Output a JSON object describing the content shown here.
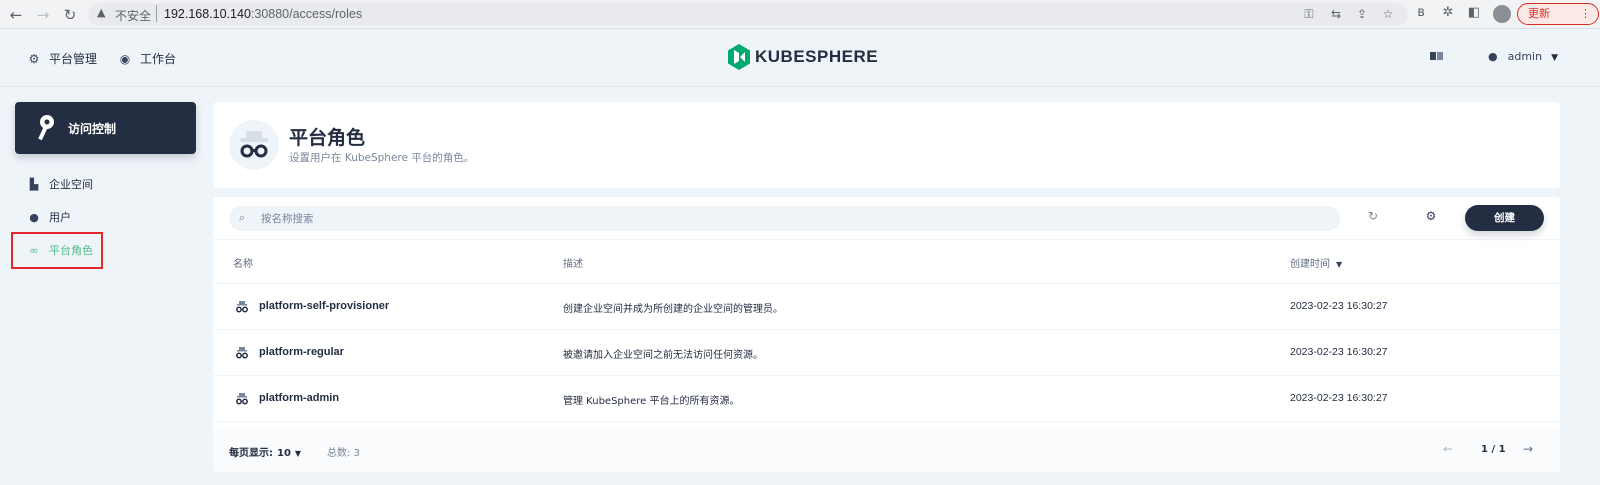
{
  "browser": {
    "insecure_label": "不安全",
    "url_host": "192.168.10.140",
    "url_rest": ":30880/access/roles",
    "update_label": "更新"
  },
  "header": {
    "nav": [
      {
        "label": "平台管理",
        "icon": "gear-icon"
      },
      {
        "label": "工作台",
        "icon": "dashboard-icon"
      }
    ],
    "brand": "KUBESPHERE",
    "user": "admin"
  },
  "sidebar": {
    "title": "访问控制",
    "items": [
      {
        "label": "企业空间",
        "icon": "enterprise-icon"
      },
      {
        "label": "用户",
        "icon": "user-icon"
      },
      {
        "label": "平台角色",
        "icon": "role-icon",
        "active": true
      }
    ]
  },
  "banner": {
    "title": "平台角色",
    "description": "设置用户在 KubeSphere 平台的角色。"
  },
  "toolbar": {
    "search_placeholder": "按名称搜索",
    "create_label": "创建"
  },
  "table": {
    "columns": [
      "名称",
      "描述",
      "创建时间"
    ],
    "rows": [
      {
        "name": "platform-self-provisioner",
        "description": "创建企业空间并成为所创建的企业空间的管理员。",
        "created": "2023-02-23 16:30:27"
      },
      {
        "name": "platform-regular",
        "description": "被邀请加入企业空间之前无法访问任何资源。",
        "created": "2023-02-23 16:30:27"
      },
      {
        "name": "platform-admin",
        "description": "管理 KubeSphere 平台上的所有资源。",
        "created": "2023-02-23 16:30:27"
      }
    ]
  },
  "pagination": {
    "per_page_label": "每页显示:",
    "per_page_value": "10",
    "total_label": "总数: 3",
    "page": "1 / 1"
  },
  "colors": {
    "accent": "#55bc8a",
    "dark": "#242e42",
    "highlight": "#e5262a"
  }
}
